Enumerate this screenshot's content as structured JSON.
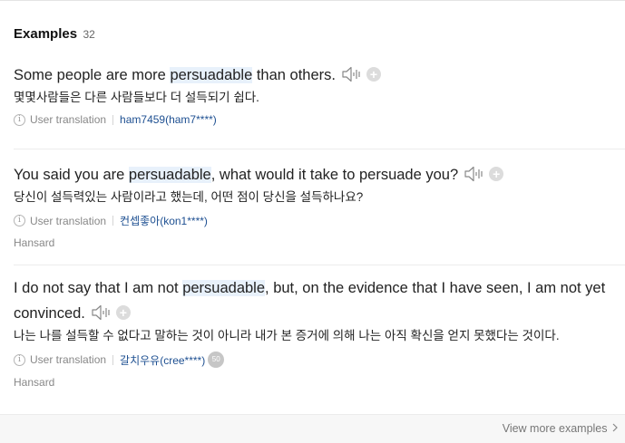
{
  "header": {
    "title": "Examples",
    "count": "32"
  },
  "examples": [
    {
      "en_before": "Some people are more ",
      "en_highlight": "persuadable",
      "en_after": " than others.",
      "ko": "몇몇사람들은 다른 사람들보다 더 설득되기 쉽다.",
      "translation_label": "User translation",
      "user": "ham7459(ham7****)"
    },
    {
      "en_before": "You said you are ",
      "en_highlight": "persuadable",
      "en_after": ", what would it take to persuade you?",
      "ko": "당신이 설득력있는 사람이라고 했는데, 어떤 점이 당신을 설득하나요?",
      "translation_label": "User translation",
      "user": "컨셉좋아(kon1****)",
      "source": "Hansard"
    },
    {
      "en_before": "I do not say that I am not ",
      "en_highlight": "persuadable",
      "en_after": ", but, on the evidence that I have seen, I am not yet convinced.",
      "ko": "나는 나를 설득할 수 없다고 말하는 것이 아니라 내가 본 증거에 의해 나는 아직 확신을 얻지 못했다는 것이다.",
      "translation_label": "User translation",
      "user": "갈치우유(cree****)",
      "badge": "50",
      "source": "Hansard"
    }
  ],
  "icons": {
    "audio": "speaker-icon",
    "add": "plus-circle-icon",
    "info": "info-icon",
    "chevron": "chevron-right-icon"
  },
  "colors": {
    "highlight_bg": "#e8f1fb",
    "user_link": "#1d4f91"
  },
  "footer": {
    "more_label": "View more examples"
  }
}
